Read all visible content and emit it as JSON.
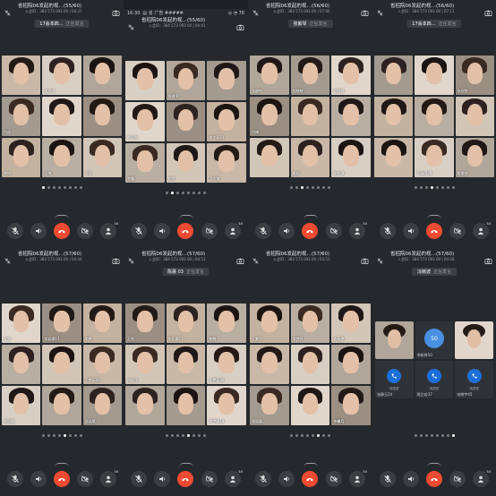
{
  "colors": {
    "background": "#1e2124",
    "hangup": "#ef4b32",
    "phone_blue": "#1d6fd8",
    "avatar_blue": "#4a90e2"
  },
  "panels": [
    {
      "title": "省招院06发起的视…(55/60)",
      "subtitle": "入会ID：384 573 093 00 | 04:37",
      "speaker": "17会本四…",
      "speaker_status": "正在发言",
      "tiles": [
        "",
        "张丹丹",
        "",
        "白丝",
        "",
        "",
        "李悦",
        "王晓",
        "冯华"
      ],
      "active_dot": 0,
      "dots": 8
    },
    {
      "status_time": "16:30",
      "status_info": "▤ 省 广告 #####",
      "status_right": "◎ ◔ 76",
      "title": "省招院06发起的视…(55/60)",
      "subtitle": "入会ID：384 573 093 00 | 04:41",
      "speaker": "",
      "speaker_status": "",
      "tiles": [
        "",
        "张晨菲",
        "",
        "刘雨彤",
        "",
        "宋艺涵21",
        "余姗",
        "程秀",
        "冯文瑄"
      ],
      "active_dot": 1,
      "dots": 8
    },
    {
      "title": "省招院06发起的视…(56/60)",
      "subtitle": "入会ID：384 573 093 00 | 07:06",
      "speaker": "张紫琴",
      "speaker_status": "正在发言",
      "tiles": [
        "张静怡",
        "程晓晓",
        "张晓蓉",
        "何婷",
        "",
        "",
        "",
        "黄阳",
        "陈艺濛"
      ],
      "active_dot": 2,
      "dots": 8
    },
    {
      "title": "省招院06发起的视…(56/60)",
      "subtitle": "入会ID：384 573 093 00 | 07:11",
      "speaker": "17会本四…",
      "speaker_status": "正在发言",
      "tiles": [
        "",
        "",
        "张欣悦",
        "",
        "",
        "",
        "",
        "王诗雨29",
        "张紫芸"
      ],
      "active_dot": 3,
      "dots": 8
    },
    {
      "title": "省招院06发起的视…(57/60)",
      "subtitle": "入会ID：384 573 093 00 | 04:44",
      "speaker": "",
      "speaker_status": "",
      "tiles": [
        "王利",
        "李彩娜17",
        "李鹏",
        "",
        "",
        "王梦茹30",
        "刘丽娜",
        "",
        "吕佳琪"
      ],
      "active_dot": 4,
      "dots": 8
    },
    {
      "title": "省招院06发起的视…(57/60)",
      "subtitle": "入会ID：384 573 093 00 | 04:53",
      "speaker": "陈晨 03",
      "speaker_status": "正在发言",
      "tiles": [
        "王利",
        "李彩娜17",
        "李鹏",
        "何红淳",
        "",
        "王梦茹30",
        "",
        "",
        "李梦瑶18"
      ],
      "active_dot": 4,
      "dots": 8
    },
    {
      "title": "省招院06发起的视…(57/60)",
      "subtitle": "入会ID：384 573 093 00 | 04:53",
      "speaker": "",
      "speaker_status": "",
      "tiles": [
        "王紫怡",
        "李梦丹",
        "许春艳",
        "",
        "",
        "",
        "张丽媛",
        "",
        "李馨月"
      ],
      "active_dot": 5,
      "dots": 8
    },
    {
      "title": "省招院06发起的视…(57/60)",
      "subtitle": "入会ID：384 573 093 00 | 04:58",
      "speaker": "冯婉波",
      "speaker_status": "正在发言",
      "video_tiles": [
        {
          "name": "",
          "type": "video"
        },
        {
          "name": "李新婷50",
          "type": "avatar",
          "avatar": "50"
        },
        {
          "name": "",
          "type": "video"
        },
        {
          "name": "张静玉24",
          "type": "phone",
          "phone_label": "纯语音"
        },
        {
          "name": "周芷若37",
          "type": "phone",
          "phone_label": "纯语音"
        },
        {
          "name": "宋晓宇45",
          "type": "phone",
          "phone_label": "纯语音"
        }
      ],
      "active_dot": 7,
      "dots": 8
    }
  ],
  "controls": {
    "badge": "54",
    "icons": [
      "mic-off-icon",
      "speaker-icon",
      "hangup-icon",
      "video-off-icon",
      "participants-icon"
    ]
  }
}
